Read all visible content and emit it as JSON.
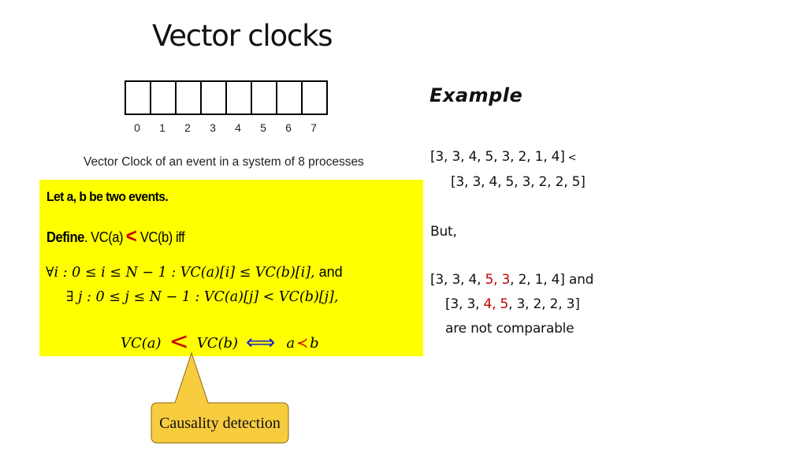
{
  "title": "Vector clocks",
  "vector_clock": {
    "indices": [
      "0",
      "1",
      "2",
      "3",
      "4",
      "5",
      "6",
      "7"
    ],
    "caption": "Vector Clock of an event in a system of 8 processes"
  },
  "definition_box": {
    "background_color": "#ffff00",
    "let_line": "Let a, b be two events.",
    "define_label": "Define",
    "define_text_a": ". VC(a)",
    "define_lt": "<",
    "define_text_b": "VC(b) iff",
    "forall_line": {
      "prefix": "∀i : 0 ≤ i ≤ N − 1 : VC(a)[i] ≤ VC(b)[i],",
      "suffix": " and"
    },
    "exists_line": "∃ j : 0 ≤ j ≤ N − 1 : VC(a)[j] < VC(b)[j],",
    "final": {
      "lhs": "VC(a)",
      "lt": "<",
      "rhs": "VC(b)",
      "iff": "⟺",
      "a": "a",
      "prec": "≺",
      "b": "b"
    }
  },
  "callout": {
    "label": "Causality detection",
    "fill_color": "#f8cc3f"
  },
  "example": {
    "title": "Example",
    "line1": "[3, 3, 4, 5, 3, 2, 1, 4]",
    "line1_lt": "<",
    "line2": "[3, 3, 4, 5, 3, 2, 2, 5]",
    "but": "But,",
    "line3": {
      "part1": "[3, 3, 4, ",
      "red": "5, 3",
      "part2": ", 2, 1, 4]  and"
    },
    "line4": {
      "part1": "[3, 3, ",
      "red": "4, 5",
      "part2": ", 3, 2, 2, 3]"
    },
    "line5": "are not comparable",
    "highlight_color": "#c00000"
  }
}
